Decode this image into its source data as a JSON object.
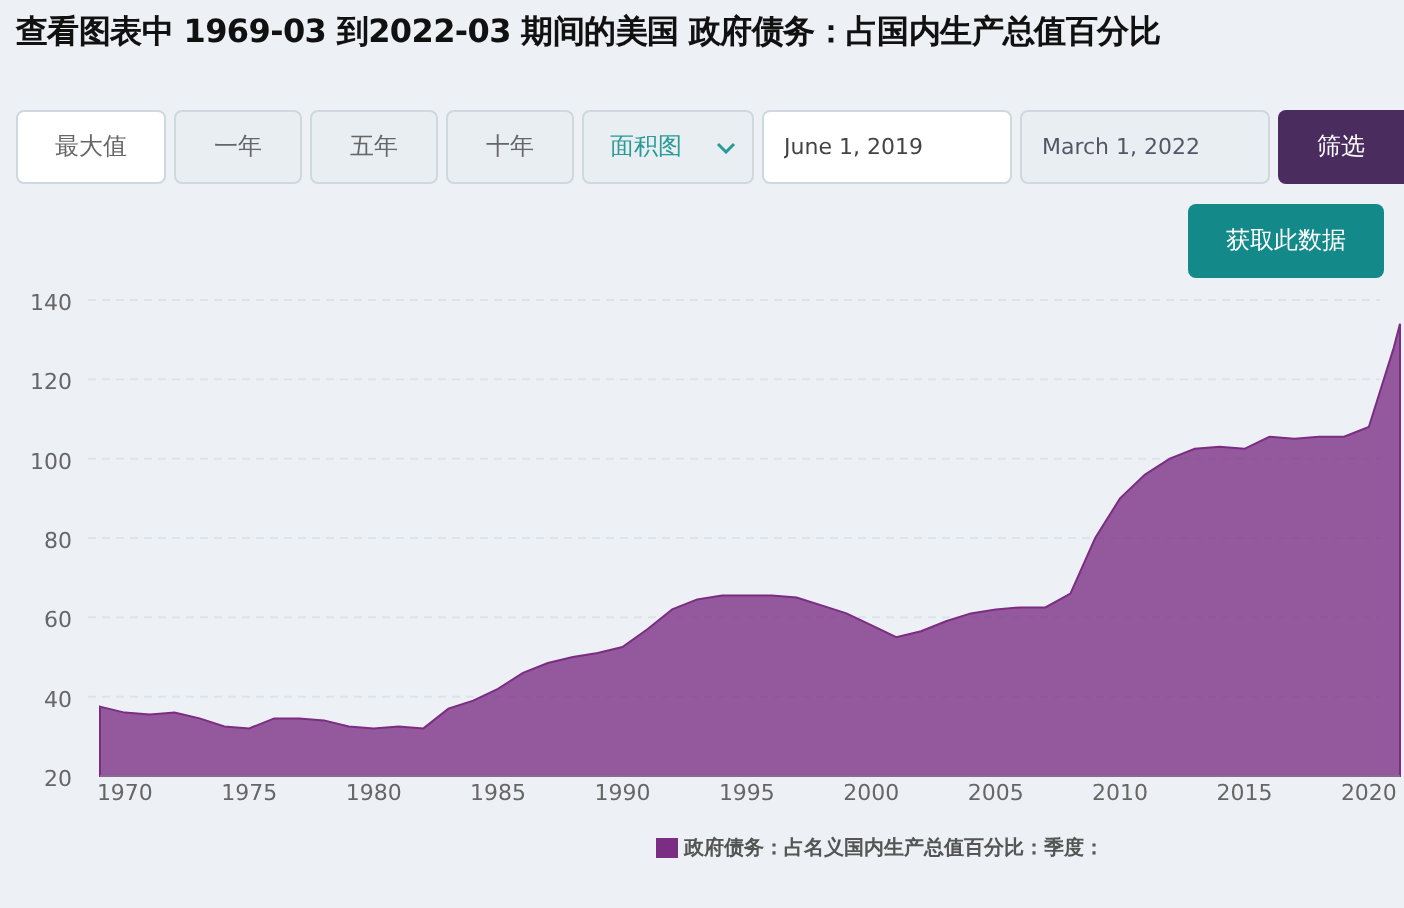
{
  "title": "查看图表中 1969-03 到2022-03 期间的美国 政府债务：占国内生产总值百分比",
  "range_buttons": [
    {
      "label": "最大值",
      "selected": true
    },
    {
      "label": "一年",
      "selected": false
    },
    {
      "label": "五年",
      "selected": false
    },
    {
      "label": "十年",
      "selected": false
    }
  ],
  "chart_type_select": {
    "value": "面积图"
  },
  "start_date": {
    "value": "June 1, 2019"
  },
  "end_date": {
    "value": "March 1, 2022"
  },
  "filter_button": {
    "label": "筛选"
  },
  "get_data_button": {
    "label": "获取此数据"
  },
  "chart": {
    "chart_data": {
      "type": "area",
      "x": [
        1969,
        1970,
        1971,
        1972,
        1973,
        1974,
        1975,
        1976,
        1977,
        1978,
        1979,
        1980,
        1981,
        1982,
        1983,
        1984,
        1985,
        1986,
        1987,
        1988,
        1989,
        1990,
        1991,
        1992,
        1993,
        1994,
        1995,
        1996,
        1997,
        1998,
        1999,
        2000,
        2001,
        2002,
        2003,
        2004,
        2005,
        2006,
        2007,
        2008,
        2009,
        2010,
        2011,
        2012,
        2013,
        2014,
        2015,
        2016,
        2017,
        2018,
        2019,
        2020,
        2021,
        2021.25
      ],
      "series": [
        {
          "name": "政府债务：占名义国内生产总值百分比：季度：",
          "color": "#7b2d83",
          "values": [
            37.5,
            36,
            35.5,
            36,
            34.5,
            32.5,
            32,
            34.5,
            34.5,
            34,
            32.5,
            32,
            32.5,
            32,
            37,
            39,
            42,
            46,
            48.5,
            50,
            51,
            52.5,
            57,
            62,
            64.5,
            65.5,
            65.5,
            65.5,
            65,
            63,
            61,
            58,
            55,
            56.5,
            59,
            61,
            62,
            62.5,
            62.5,
            66,
            80,
            90,
            96,
            100,
            102.5,
            103,
            102.5,
            105.5,
            105,
            105.5,
            105.5,
            108,
            128,
            134
          ]
        }
      ],
      "xlim": [
        1969,
        2021.25
      ],
      "ylim": [
        20,
        140
      ],
      "grid": true,
      "xticks": [
        1970,
        1975,
        1980,
        1985,
        1990,
        1995,
        2000,
        2005,
        2010,
        2015,
        2020
      ],
      "yticks": [
        20,
        40,
        60,
        80,
        100,
        120,
        140
      ]
    }
  }
}
